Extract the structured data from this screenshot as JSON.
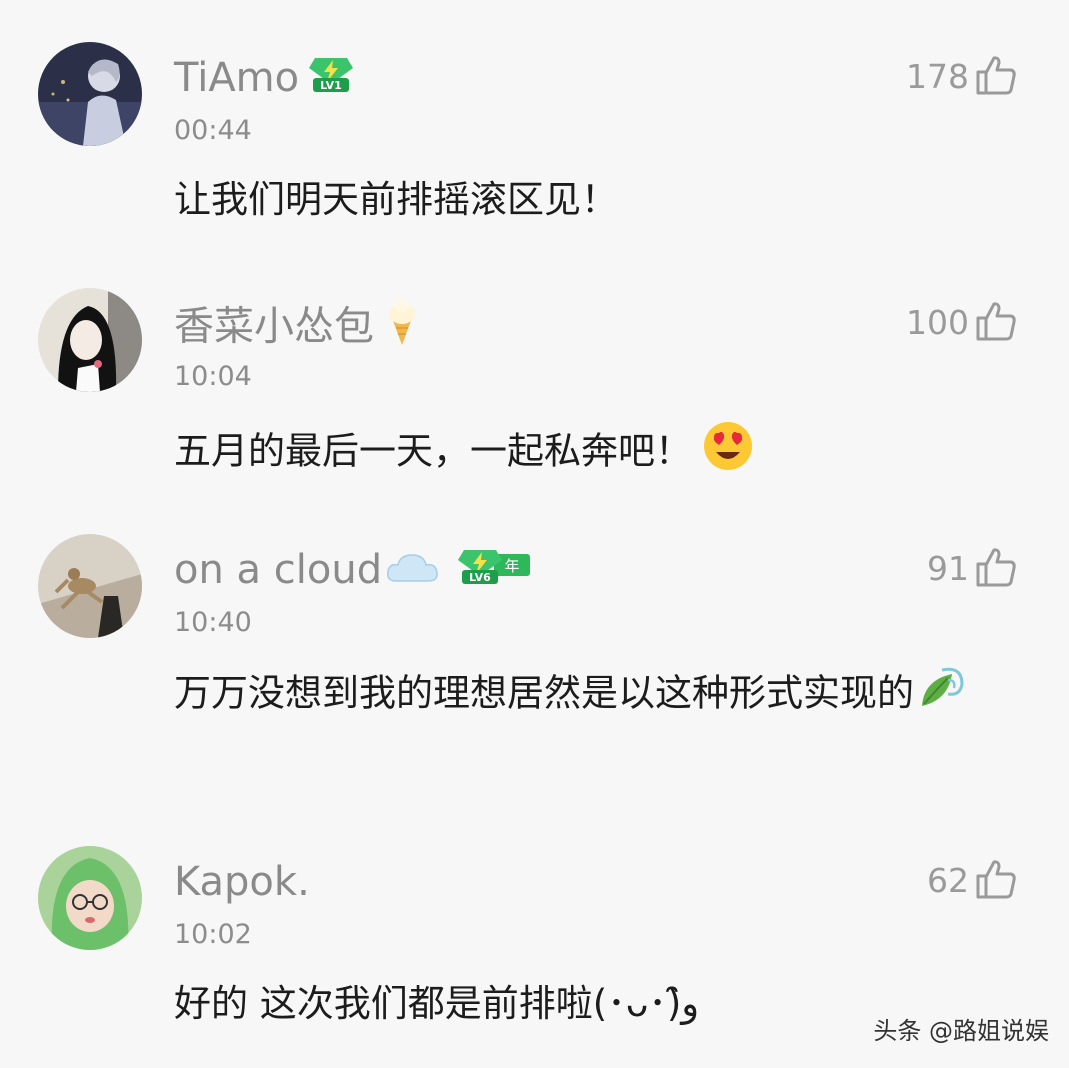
{
  "comments": [
    {
      "username": "TiAmo",
      "badge": {
        "icon": "level-badge-icon",
        "level": "LV1"
      },
      "time": "00:44",
      "likes": "178",
      "text": "让我们明天前排摇滚区见！"
    },
    {
      "username": "香菜小怂包",
      "emoji": "ice-cream-icon",
      "time": "10:04",
      "likes": "100",
      "text": "五月的最后一天，一起私奔吧！",
      "text_emoji": "heart-eyes-emoji-icon"
    },
    {
      "username": "on a cloud",
      "emoji": "cloud-icon",
      "badge": {
        "icon": "level-badge-icon",
        "level": "LV6",
        "extra": "年"
      },
      "time": "10:40",
      "likes": "91",
      "text": "万万没想到我的理想居然是以这种形式实现的",
      "text_emoji": "leaf-wind-emoji-icon"
    },
    {
      "username": "Kapok.",
      "time": "10:02",
      "likes": "62",
      "text": "好的 这次我们都是前排啦(･ᴗ･)و̑̑"
    }
  ],
  "watermark": "头条 @路姐说娱",
  "colors": {
    "badge_green": "#2fb85a",
    "like_gray": "#9a9a9a"
  }
}
